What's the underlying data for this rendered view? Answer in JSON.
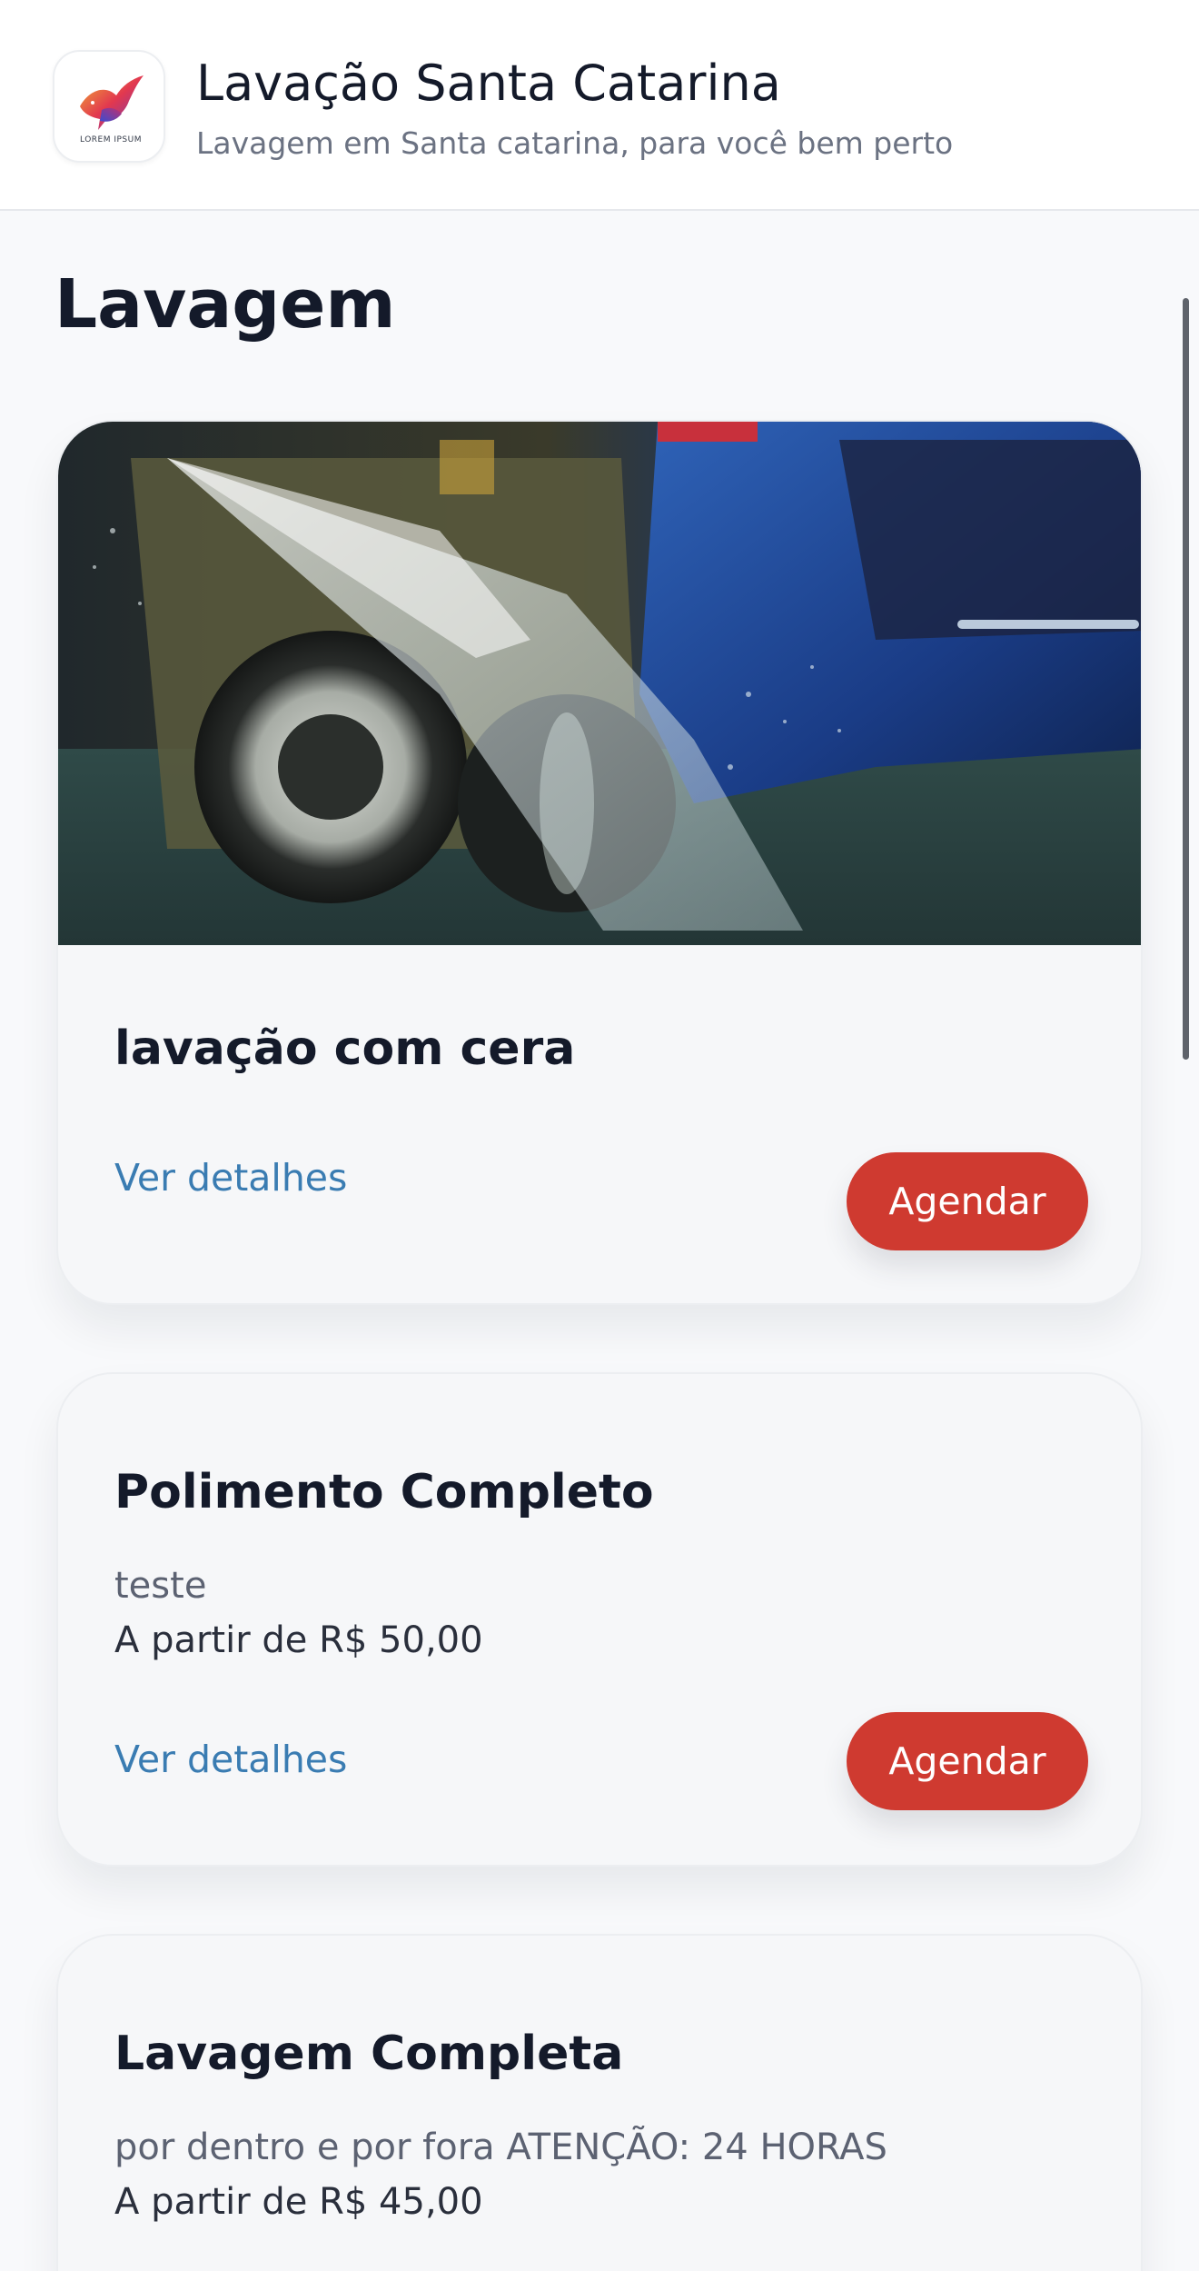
{
  "header": {
    "logo_text": "LOREM IPSUM",
    "title": "Lavação Santa Catarina",
    "subtitle": "Lavagem em Santa catarina, para você bem perto"
  },
  "section": {
    "title": "Lavagem"
  },
  "services": [
    {
      "title": "lavação com cera",
      "image": "car-wash-photo",
      "details_label": "Ver detalhes",
      "book_label": "Agendar"
    },
    {
      "title": "Polimento Completo",
      "description": "teste",
      "price": "A partir de R$ 50,00",
      "details_label": "Ver detalhes",
      "book_label": "Agendar"
    },
    {
      "title": "Lavagem Completa",
      "description": "por dentro e por fora ATENÇÃO: 24 HORAS",
      "price": "A partir de R$ 45,00"
    }
  ],
  "colors": {
    "accent_button": "#cf3a30",
    "link": "#3a7cb2",
    "background": "#f8f9fb",
    "card": "#f6f7f9"
  }
}
